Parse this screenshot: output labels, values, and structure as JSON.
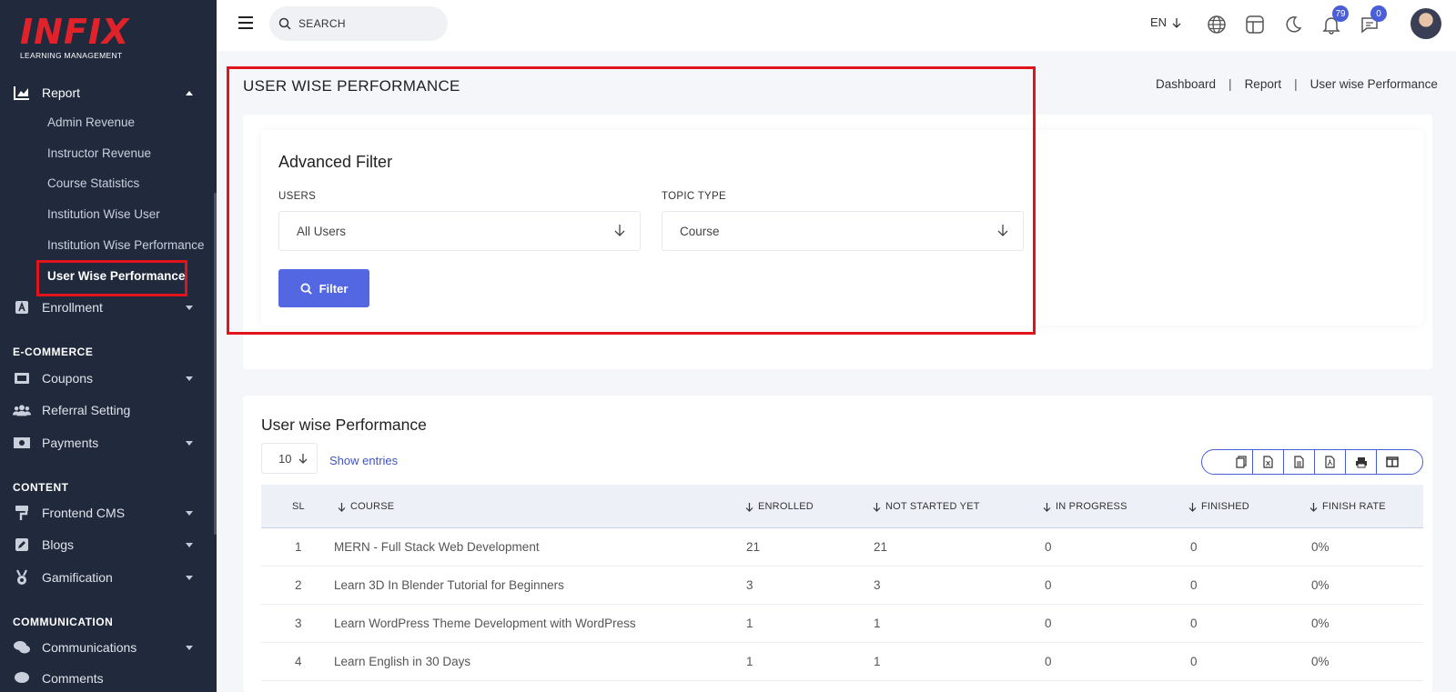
{
  "app": {
    "logo_text": "INFIX",
    "logo_subtitle": "LEARNING MANAGEMENT"
  },
  "sidebar": {
    "report": {
      "label": "Report",
      "icon": "chart-area-icon"
    },
    "report_items": [
      {
        "label": "Admin Revenue"
      },
      {
        "label": "Instructor Revenue"
      },
      {
        "label": "Course Statistics"
      },
      {
        "label": "Institution Wise User"
      },
      {
        "label": "Institution Wise Performance"
      },
      {
        "label": "User Wise Performance",
        "active": true
      }
    ],
    "enrollment": {
      "label": "Enrollment",
      "icon": "enrollment-icon"
    },
    "sections": {
      "ecommerce": "E-COMMERCE",
      "content": "CONTENT",
      "communication": "COMMUNICATION"
    },
    "ecommerce_items": [
      {
        "label": "Coupons",
        "icon": "ticket-icon"
      },
      {
        "label": "Referral Setting",
        "icon": "users-icon"
      },
      {
        "label": "Payments",
        "icon": "money-icon"
      }
    ],
    "content_items": [
      {
        "label": "Frontend CMS",
        "icon": "paint-roller-icon"
      },
      {
        "label": "Blogs",
        "icon": "edit-icon"
      },
      {
        "label": "Gamification",
        "icon": "medal-icon"
      }
    ],
    "communication_items": [
      {
        "label": "Communications",
        "icon": "comments-icon"
      },
      {
        "label": "Comments",
        "icon": "comment-icon"
      }
    ]
  },
  "header": {
    "search_placeholder": "SEARCH",
    "language": "EN",
    "notifications_count": "79",
    "messages_count": "0"
  },
  "page": {
    "title": "USER WISE PERFORMANCE",
    "breadcrumb": [
      "Dashboard",
      "Report",
      "User wise Performance"
    ]
  },
  "filter": {
    "title": "Advanced Filter",
    "users_label": "USERS",
    "users_value": "All Users",
    "topic_label": "TOPIC TYPE",
    "topic_value": "Course",
    "button_label": "Filter"
  },
  "table": {
    "title": "User wise Performance",
    "page_size": "10",
    "entries_label": "Show entries",
    "columns": [
      "SL",
      "COURSE",
      "ENROLLED",
      "NOT STARTED YET",
      "IN PROGRESS",
      "FINISHED",
      "FINISH RATE"
    ],
    "rows": [
      {
        "sl": "1",
        "course": "MERN - Full Stack Web Development",
        "enrolled": "21",
        "not_started": "21",
        "in_progress": "0",
        "finished": "0",
        "finish_rate": "0%"
      },
      {
        "sl": "2",
        "course": "Learn 3D In Blender Tutorial for Beginners",
        "enrolled": "3",
        "not_started": "3",
        "in_progress": "0",
        "finished": "0",
        "finish_rate": "0%"
      },
      {
        "sl": "3",
        "course": "Learn WordPress Theme Development with WordPress",
        "enrolled": "1",
        "not_started": "1",
        "in_progress": "0",
        "finished": "0",
        "finish_rate": "0%"
      },
      {
        "sl": "4",
        "course": "Learn English in 30 Days",
        "enrolled": "1",
        "not_started": "1",
        "in_progress": "0",
        "finished": "0",
        "finish_rate": "0%"
      }
    ]
  },
  "colors": {
    "sidebar_bg": "#202a3c",
    "accent": "#5367e3",
    "highlight": "#e3131b",
    "logo": "#e1222b"
  }
}
